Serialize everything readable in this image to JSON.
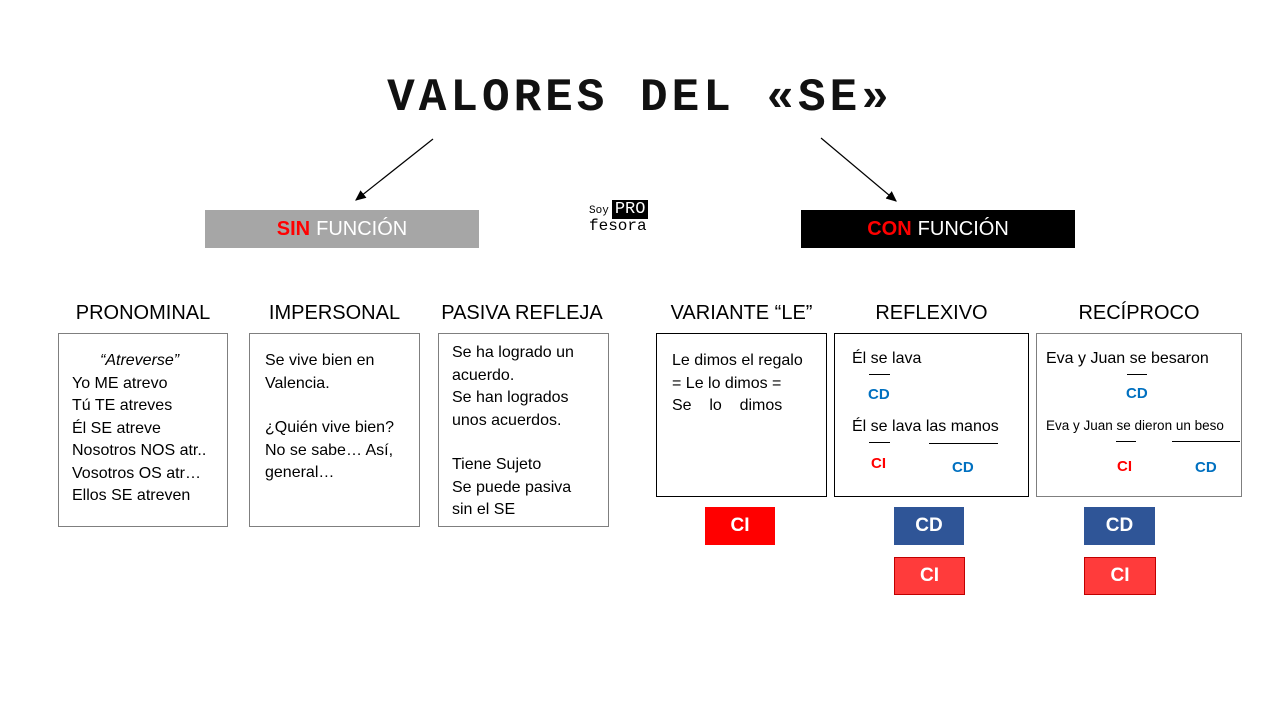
{
  "title": "VALORES DEL «SE»",
  "logo": {
    "soy": "Soy",
    "pro": "PRO",
    "fesora": "fesora"
  },
  "categories": {
    "sin": {
      "emph": "SIN",
      "rest": "FUNCIÓN",
      "bg": "#a6a6a6"
    },
    "con": {
      "emph": "CON",
      "rest": "FUNCIÓN",
      "bg": "#000000"
    }
  },
  "columns": {
    "pronominal": {
      "heading": "PRONOMINAL",
      "lines": [
        "“Atreverse”",
        "Yo ME atrevo",
        "Tú TE atreves",
        "Él SE atreve",
        "Nosotros NOS atr..",
        "Vosotros OS atr…",
        "Ellos SE atreven"
      ]
    },
    "impersonal": {
      "heading": "IMPERSONAL",
      "lines": [
        "Se vive bien en",
        "Valencia.",
        "",
        "¿Quién vive bien?",
        "No se sabe… Así,",
        "general…"
      ]
    },
    "pasiva": {
      "heading": "PASIVA REFLEJA",
      "lines": [
        "Se ha logrado un",
        "acuerdo.",
        "Se han logrados",
        "unos acuerdos.",
        "",
        "Tiene Sujeto",
        "Se puede pasiva",
        "sin el SE"
      ]
    },
    "variante": {
      "heading": "VARIANTE “LE”",
      "lines": [
        "Le dimos el regalo",
        "= Le lo dimos =",
        "Se    lo    dimos"
      ],
      "badges": [
        "CI"
      ]
    },
    "reflexivo": {
      "heading": "REFLEXIVO",
      "sentence1": "Él se lava",
      "label1": "CD",
      "sentence2": "Él se lava las manos",
      "label2a": "CI",
      "label2b": "CD",
      "badges": [
        "CD",
        "CI"
      ]
    },
    "reciproco": {
      "heading": "RECÍPROCO",
      "sentence1": "Eva y Juan se besaron",
      "label1": "CD",
      "sentence2": "Eva y Juan se dieron un beso",
      "label2a": "CI",
      "label2b": "CD",
      "badges": [
        "CD",
        "CI"
      ]
    }
  },
  "colors": {
    "cd": "#0070c0",
    "ci": "#ff0000",
    "badge_blue": "#2f5597",
    "badge_red": "#ff0000"
  }
}
